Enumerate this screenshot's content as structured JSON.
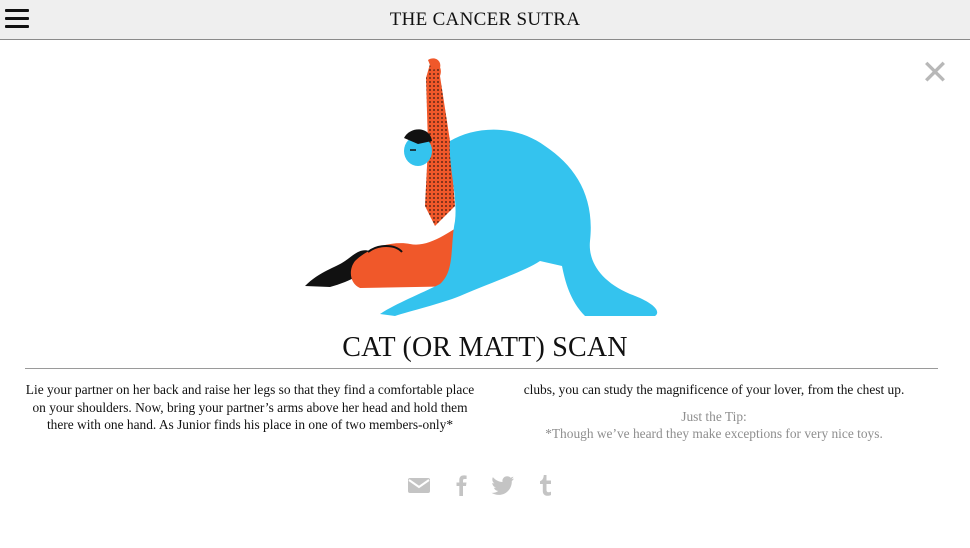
{
  "header": {
    "site_title": "THE CANCER SUTRA",
    "menu_icon": "hamburger-menu-icon"
  },
  "modal": {
    "close_icon": "close-icon",
    "position_title": "CAT (OR MATT) SCAN",
    "body_left": "Lie your partner on her back and raise her legs so that they find a comfortable place on your shoulders. Now, bring your partner’s arms above her head and hold them there with one hand. As Junior finds his place in one of two members-only*",
    "body_right": "clubs, you can study the magnificence of your lover, from the chest up.",
    "tip_label": "Just the Tip:",
    "tip_text": "*Though we’ve heard they make exceptions for very nice toys."
  },
  "share": {
    "icons": [
      "email-icon",
      "facebook-icon",
      "twitter-icon",
      "tumblr-icon"
    ],
    "color": "#c4c4c4"
  },
  "colors": {
    "blue_figure": "#34c3ee",
    "orange_figure": "#f0582a",
    "dark": "#111111",
    "topbar_bg": "#efefef"
  }
}
